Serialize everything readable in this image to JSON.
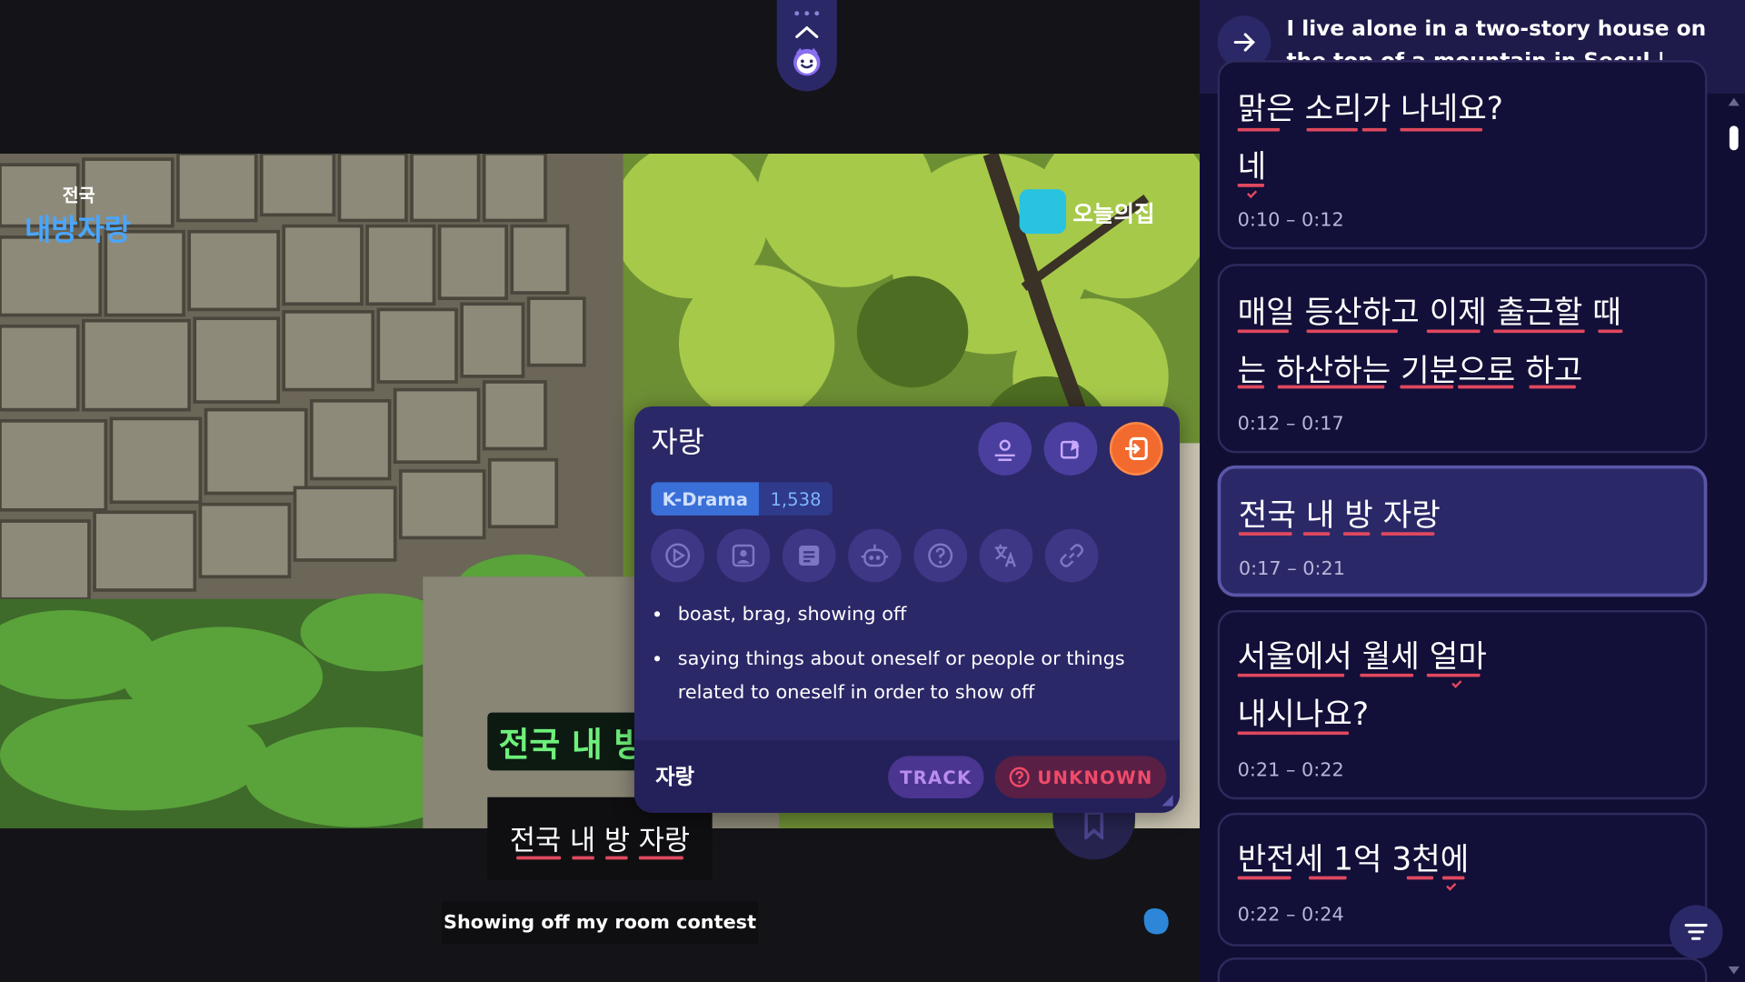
{
  "video": {
    "brand_line1": "전국",
    "brand_line2": "내방자랑",
    "channel_text": "오늘의집",
    "burned_subtitle": "전국 내 방"
  },
  "subtitle_korean": "전국 내 방 자랑",
  "subtitle_english": "Showing off my room contest",
  "popup": {
    "word": "자랑",
    "tag": "K-Drama",
    "frequency": "1,538",
    "definitions": [
      "boast, brag, showing off",
      "saying things about oneself or people or things related to oneself in order to show off"
    ],
    "footer_word": "자랑",
    "track_label": "TRACK",
    "unknown_label": "UNKNOWN",
    "tools": [
      "play-icon",
      "image-icon",
      "document-icon",
      "robot-icon",
      "question-icon",
      "translate-icon",
      "link-icon"
    ]
  },
  "panel": {
    "title": "I live alone in a two-story house on the top of a mountain in Seoul | Showing of...",
    "cards": [
      {
        "lines": [
          "맑은 소리가 나네요?",
          "네"
        ],
        "time": "0:10 – 0:12"
      },
      {
        "lines": [
          "매일 등산하고 이제 출근할 때",
          "는 하산하는 기분으로 하고"
        ],
        "time": "0:12 – 0:17"
      },
      {
        "lines": [
          "전국 내 방 자랑"
        ],
        "time": "0:17 – 0:21"
      },
      {
        "lines": [
          "서울에서 월세 얼마",
          "내시나요?"
        ],
        "time": "0:21 – 0:22"
      },
      {
        "lines": [
          "반전세 1억 3천에"
        ],
        "time": "0:22 – 0:24"
      }
    ]
  },
  "colors": {
    "panel_bg": "#110e33",
    "popup_bg": "#2b2868",
    "underline": "#e0485e",
    "accent_orange": "#f26a2e",
    "tag_blue": "#3a6fd8"
  }
}
